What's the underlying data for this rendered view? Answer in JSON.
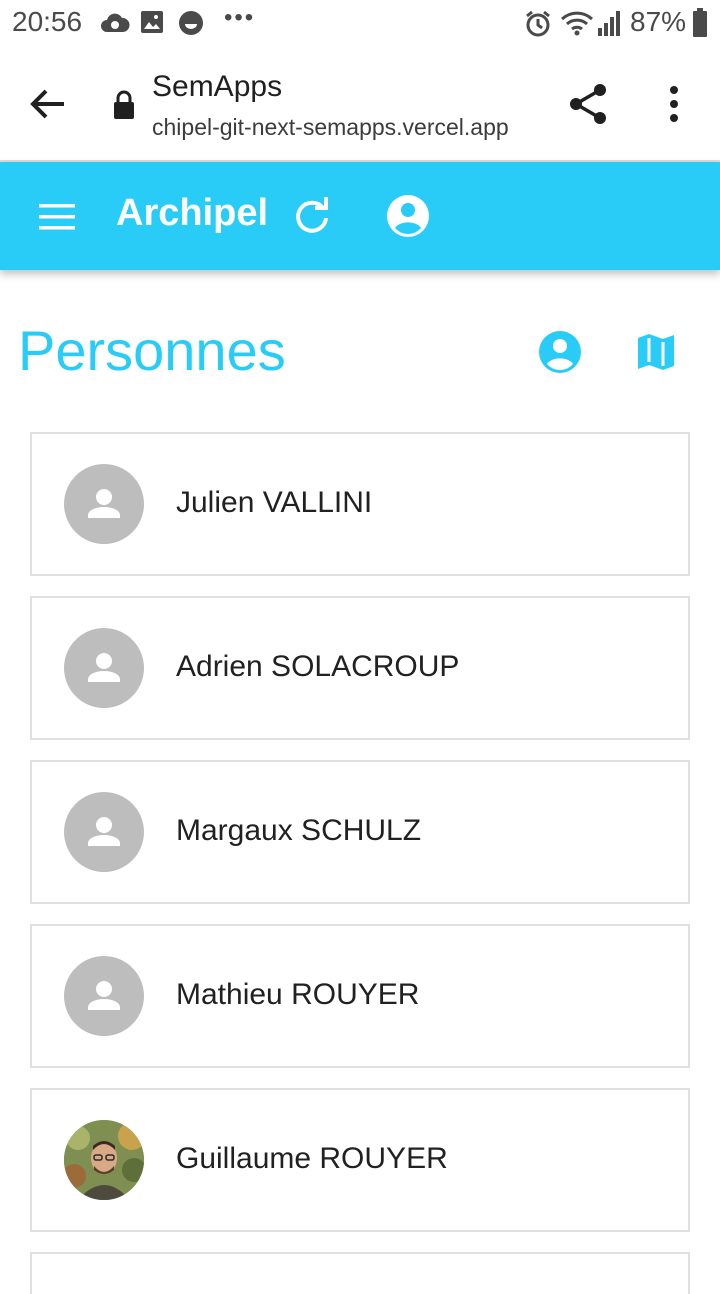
{
  "status_bar": {
    "time": "20:56",
    "battery": "87%",
    "icons": [
      "cloud-sync-icon",
      "image-icon",
      "face-icon",
      "alarm-icon",
      "wifi-icon",
      "signal-icon",
      "battery-icon"
    ]
  },
  "browser": {
    "title": "SemApps",
    "url": "chipel-git-next-semapps.vercel.app",
    "icons": [
      "back-arrow-icon",
      "lock-icon",
      "share-icon",
      "more-vert-icon"
    ]
  },
  "app_bar": {
    "title": "Archipel",
    "color": "#29ccf7",
    "icons": [
      "menu-icon",
      "refresh-icon",
      "account-circle-icon"
    ]
  },
  "page": {
    "title": "Personnes",
    "view_icons": [
      "account-circle-icon",
      "map-icon"
    ]
  },
  "persons": [
    {
      "name": "Julien VALLINI",
      "avatar": "placeholder"
    },
    {
      "name": "Adrien SOLACROUP",
      "avatar": "placeholder"
    },
    {
      "name": "Margaux SCHULZ",
      "avatar": "placeholder"
    },
    {
      "name": "Mathieu ROUYER",
      "avatar": "placeholder"
    },
    {
      "name": "Guillaume ROUYER",
      "avatar": "photo"
    }
  ]
}
